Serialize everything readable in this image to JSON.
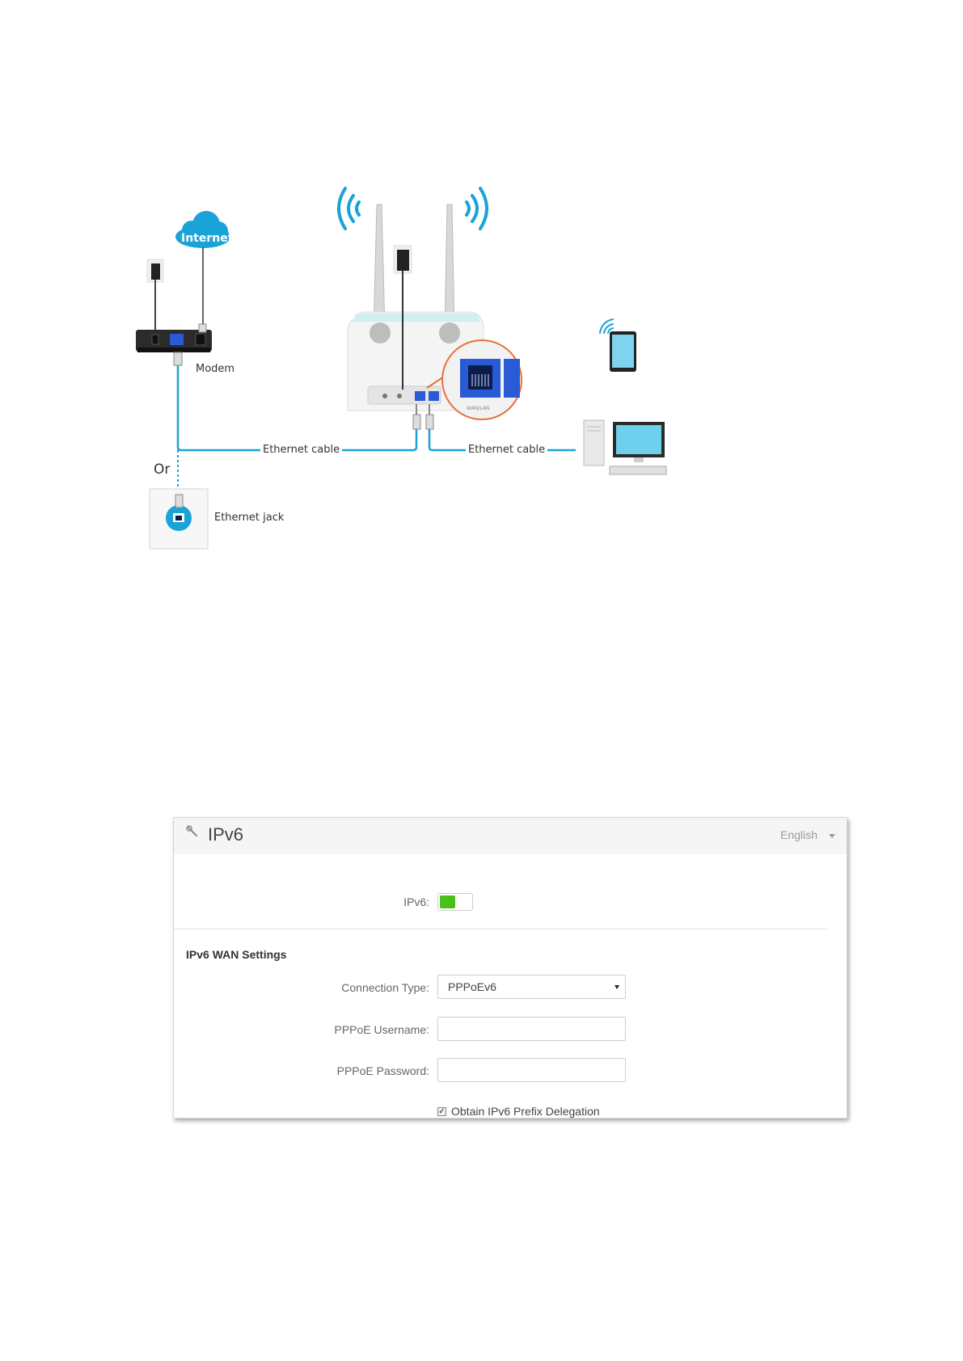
{
  "diagram": {
    "internet": "Internet",
    "modem": "Modem",
    "ethernet_cable_left": "Ethernet cable",
    "ethernet_cable_right": "Ethernet cable",
    "or": "Or",
    "ethernet_jack": "Ethernet jack",
    "port_label": "WAN/LAN"
  },
  "panel": {
    "title": "IPv6",
    "language": "English",
    "ipv6_label": "IPv6:",
    "ipv6_enabled": true,
    "section_title": "IPv6 WAN Settings",
    "connection_type_label": "Connection Type:",
    "connection_type_value": "PPPoEv6",
    "username_label": "PPPoE Username:",
    "username_value": "",
    "password_label": "PPPoE Password:",
    "password_value": "",
    "prefix_delegation_label": "Obtain IPv6 Prefix Delegation",
    "prefix_delegation_checked": true
  },
  "colors": {
    "accent_blue": "#1aa3d9",
    "toggle_green": "#4cbf1a",
    "port_blue": "#2a5bd7"
  }
}
